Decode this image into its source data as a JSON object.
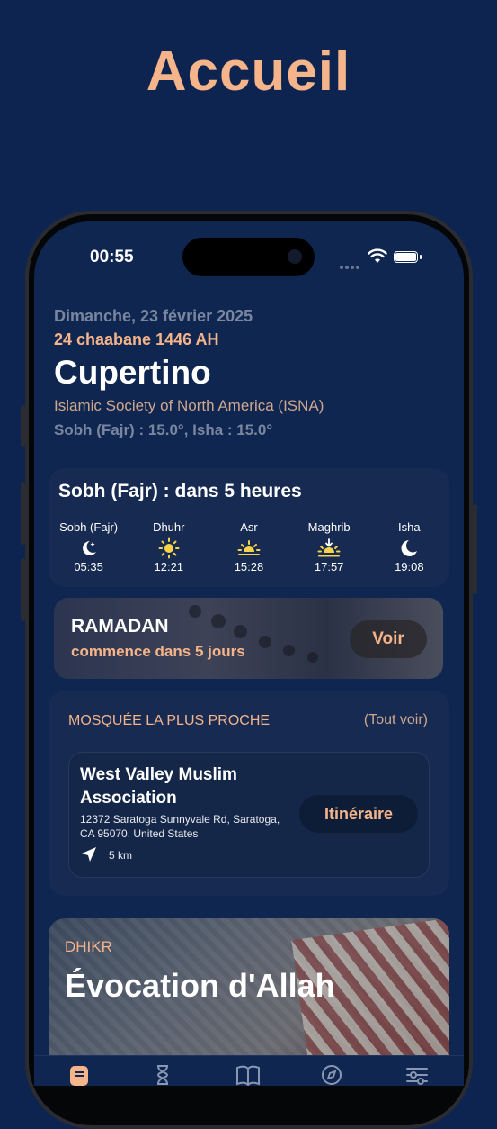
{
  "page_title": "Accueil",
  "status_bar": {
    "time": "00:55"
  },
  "header": {
    "gregorian_date": "Dimanche, 23 février 2025",
    "hijri_date": "24 chaabane 1446 AH",
    "city": "Cupertino",
    "method": "Islamic Society of North America (ISNA)",
    "angles": "Sobh (Fajr) : 15.0°, Isha : 15.0°"
  },
  "prayer_times": {
    "next_label": "Sobh (Fajr) : dans 5 heures",
    "items": [
      {
        "name": "Sobh (Fajr)",
        "time": "05:35",
        "icon": "moon-star-icon"
      },
      {
        "name": "Dhuhr",
        "time": "12:21",
        "icon": "sun-icon"
      },
      {
        "name": "Asr",
        "time": "15:28",
        "icon": "sun-horizon-icon"
      },
      {
        "name": "Maghrib",
        "time": "17:57",
        "icon": "sunset-icon"
      },
      {
        "name": "Isha",
        "time": "19:08",
        "icon": "moon-icon"
      }
    ]
  },
  "ramadan": {
    "title": "RAMADAN",
    "subtitle": "commence dans 5 jours",
    "button": "Voir"
  },
  "mosque": {
    "section_title": "MOSQUÉE LA PLUS PROCHE",
    "see_all": "(Tout voir)",
    "name": "West Valley Muslim Association",
    "address": "12372 Saratoga Sunnyvale Rd, Saratoga, CA 95070, United States",
    "distance": "5 km",
    "button": "Itinéraire"
  },
  "dhikr": {
    "label": "DHIKR",
    "title": "Évocation d'Allah"
  },
  "colors": {
    "background": "#0d2451",
    "accent": "#f5b48a",
    "card": "#162a52"
  }
}
